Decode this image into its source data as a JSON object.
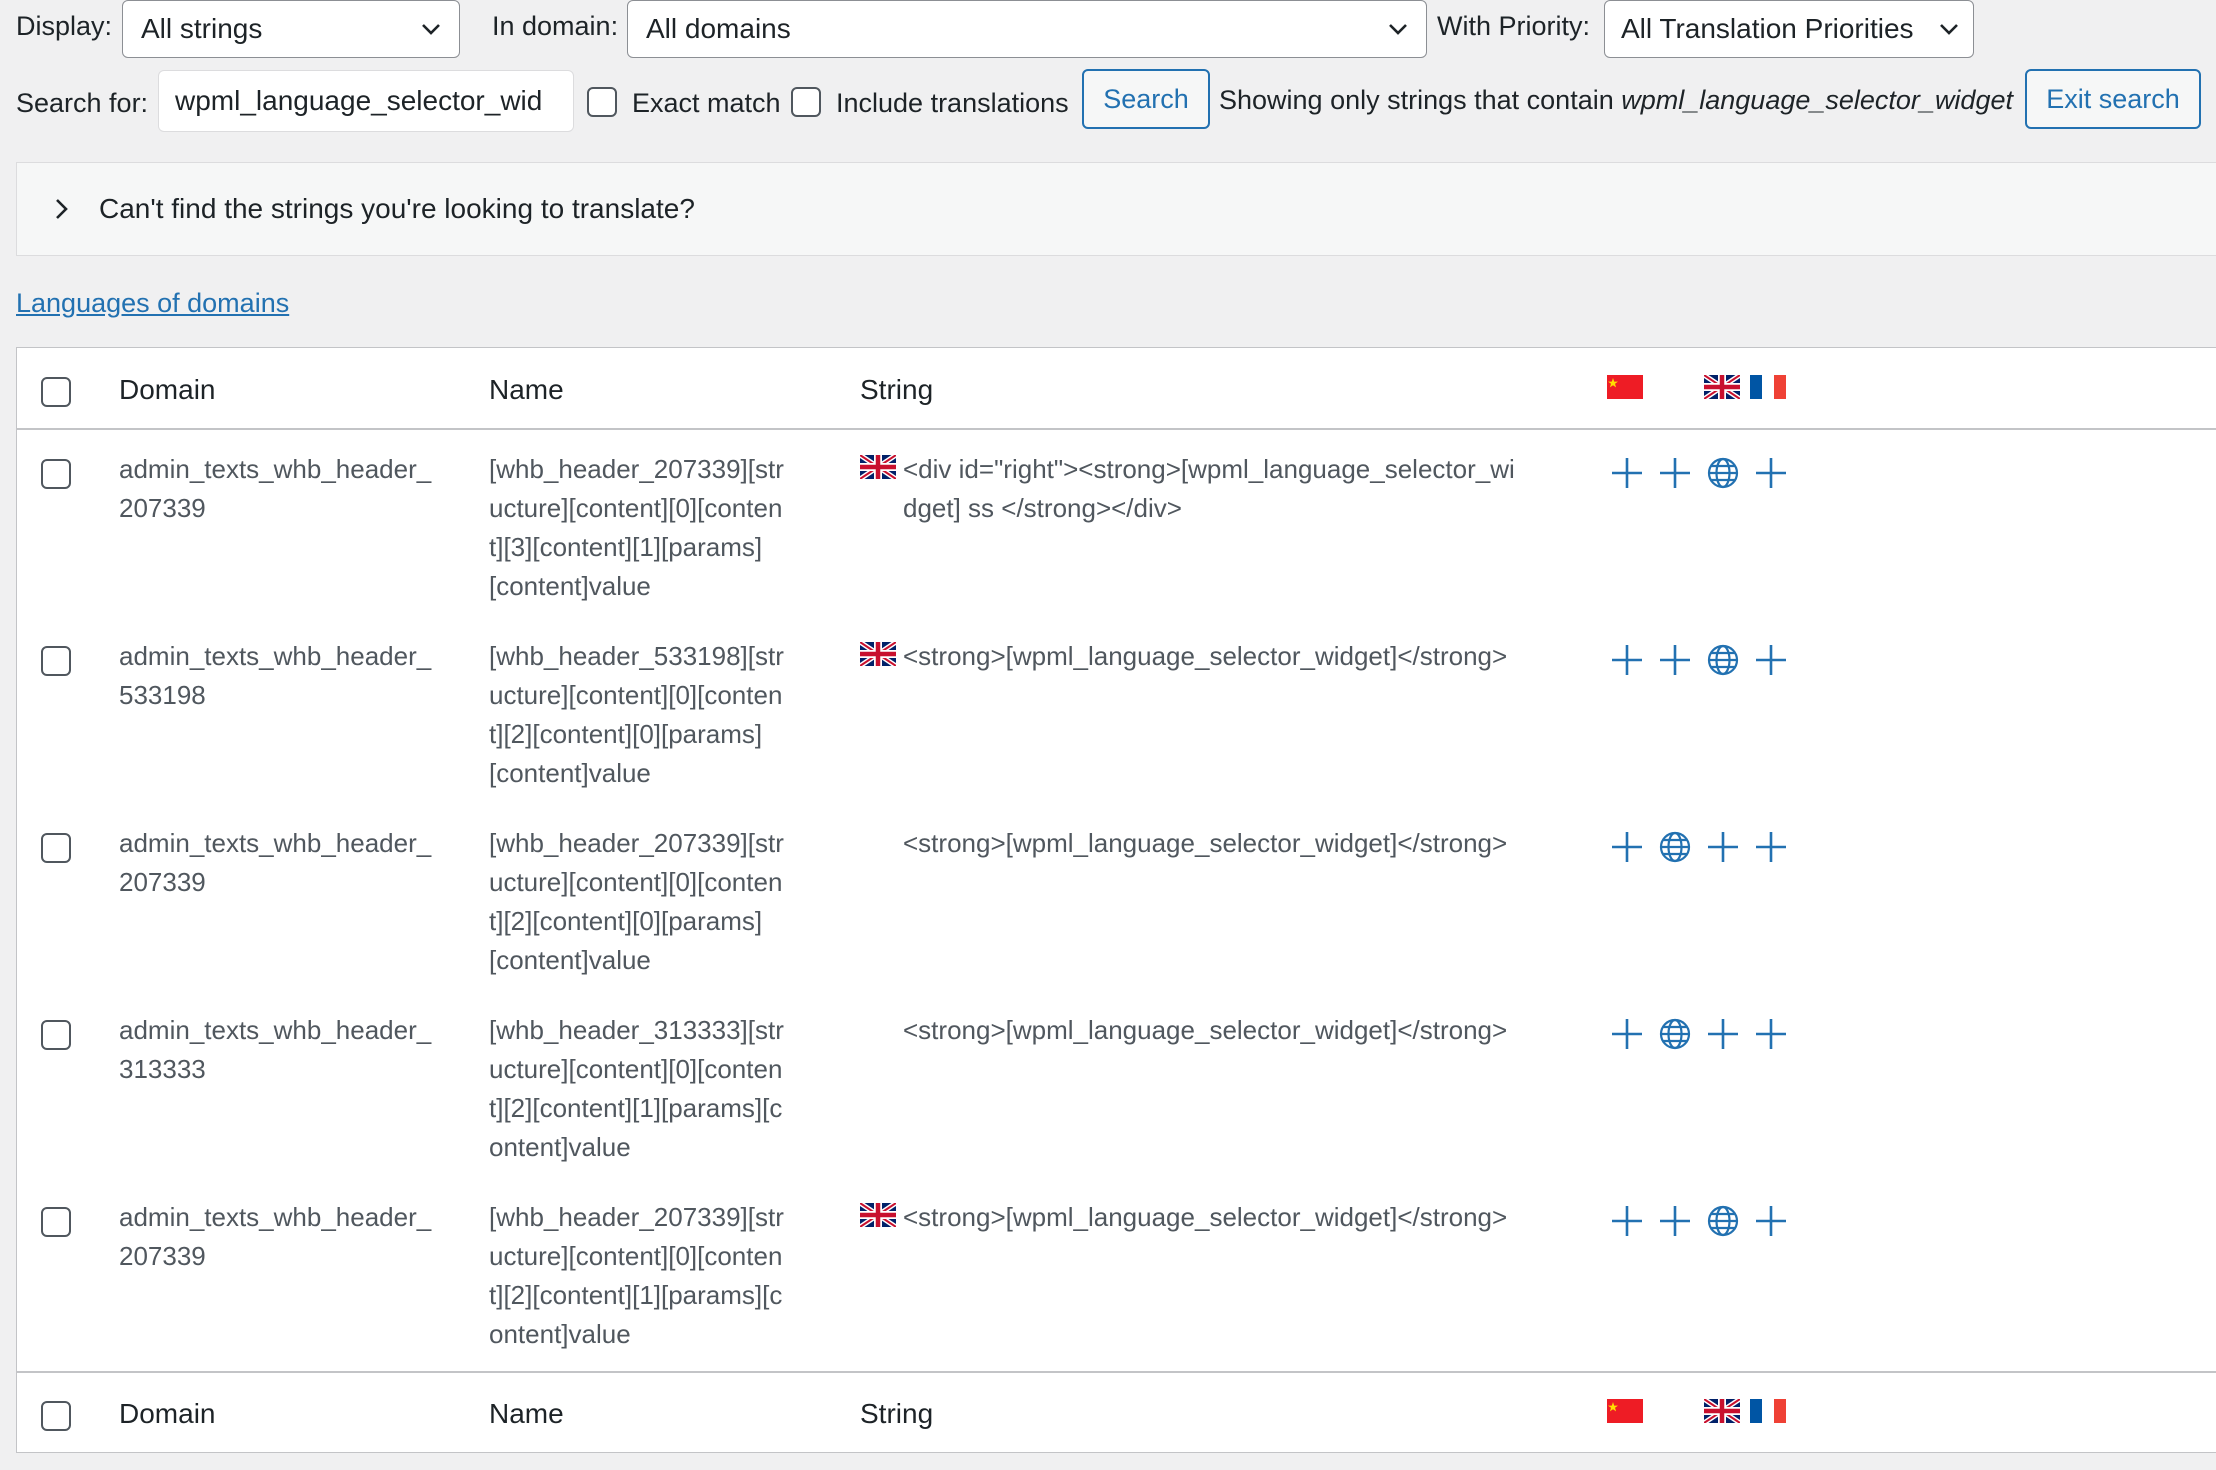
{
  "filters": {
    "display_label": "Display:",
    "display_value": "All strings",
    "domain_label": "In domain:",
    "domain_value": "All domains",
    "priority_label": "With Priority:",
    "priority_value": "All Translation Priorities"
  },
  "search": {
    "label": "Search for:",
    "value": "wpml_language_selector_wid",
    "exact_match": "Exact match",
    "include_translations": "Include translations",
    "button": "Search",
    "status_prefix": "Showing only strings that contain ",
    "status_term": "wpml_language_selector_widget",
    "exit_button": "Exit search"
  },
  "notice": {
    "text": "Can't find the strings you're looking to translate?"
  },
  "languages_link": "Languages of domains",
  "table": {
    "columns": {
      "domain": "Domain",
      "name": "Name",
      "string": "String"
    },
    "rows": [
      {
        "domain": [
          "admin_texts_whb_header_",
          "207339"
        ],
        "name": [
          "[whb_header_207339][str",
          "ucture][content][0][conten",
          "t][3][content][1][params]",
          "[content]value"
        ],
        "string": [
          "<div id=\"right\"><strong>[wpml_language_selector_wi",
          "dget] ss </strong></div>"
        ],
        "has_flag": true,
        "icons": [
          "plus",
          "plus",
          "globe",
          "plus"
        ]
      },
      {
        "domain": [
          "admin_texts_whb_header_",
          "533198"
        ],
        "name": [
          "[whb_header_533198][str",
          "ucture][content][0][conten",
          "t][2][content][0][params]",
          "[content]value"
        ],
        "string": [
          "<strong>[wpml_language_selector_widget]</strong>"
        ],
        "has_flag": true,
        "icons": [
          "plus",
          "plus",
          "globe",
          "plus"
        ]
      },
      {
        "domain": [
          "admin_texts_whb_header_",
          "207339"
        ],
        "name": [
          "[whb_header_207339][str",
          "ucture][content][0][conten",
          "t][2][content][0][params]",
          "[content]value"
        ],
        "string": [
          "<strong>[wpml_language_selector_widget]</strong>"
        ],
        "has_flag": false,
        "icons": [
          "plus",
          "globe",
          "plus",
          "plus"
        ]
      },
      {
        "domain": [
          "admin_texts_whb_header_",
          "313333"
        ],
        "name": [
          "[whb_header_313333][str",
          "ucture][content][0][conten",
          "t][2][content][1][params][c",
          "ontent]value"
        ],
        "string": [
          "<strong>[wpml_language_selector_widget]</strong>"
        ],
        "has_flag": false,
        "icons": [
          "plus",
          "globe",
          "plus",
          "plus"
        ]
      },
      {
        "domain": [
          "admin_texts_whb_header_",
          "207339"
        ],
        "name": [
          "[whb_header_207339][str",
          "ucture][content][0][conten",
          "t][2][content][1][params][c",
          "ontent]value"
        ],
        "string": [
          "<strong>[wpml_language_selector_widget]</strong>"
        ],
        "has_flag": true,
        "icons": [
          "plus",
          "plus",
          "globe",
          "plus"
        ]
      }
    ]
  },
  "header_flags": [
    "flag-cn-icon",
    "flag-gb-icon",
    "flag-fr-icon"
  ],
  "colors": {
    "accent": "#2271b1",
    "border": "#c3c4c7",
    "background": "#f0f0f1"
  }
}
